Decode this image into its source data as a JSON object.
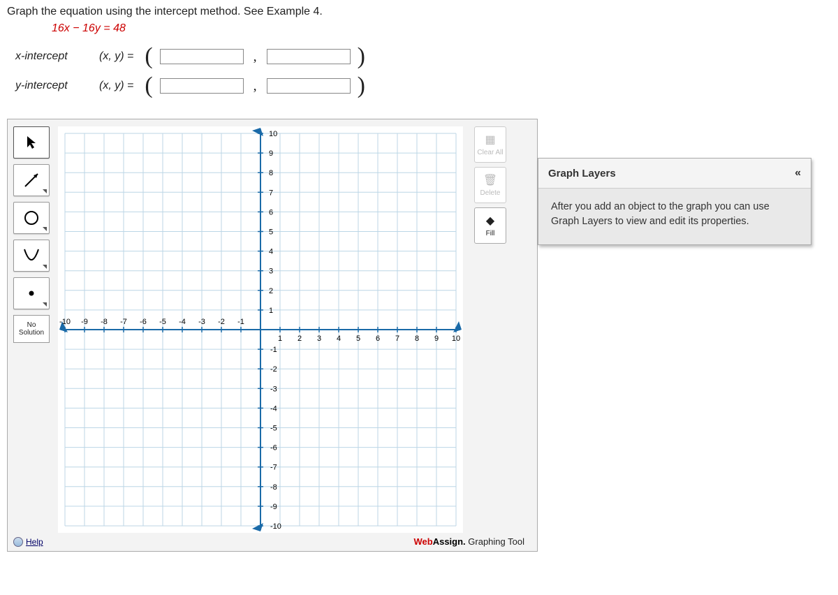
{
  "question": {
    "prompt": "Graph the equation using the intercept method. See Example 4.",
    "equation": "16x − 16y = 48",
    "intercepts": [
      {
        "label": "x-intercept",
        "xy": "(x, y) ="
      },
      {
        "label": "y-intercept",
        "xy": "(x, y) ="
      }
    ]
  },
  "toolbar": {
    "no_solution": "No Solution",
    "help": "Help"
  },
  "side_buttons": {
    "clear": "Clear All",
    "delete": "Delete",
    "fill": "Fill"
  },
  "layers": {
    "title": "Graph Layers",
    "body": "After you add an object to the graph you can use Graph Layers to view and edit its properties."
  },
  "branding": {
    "wa": "WebAssign.",
    "tool": " Graphing Tool"
  },
  "chart_data": {
    "type": "scatter",
    "title": "",
    "xlabel": "",
    "ylabel": "",
    "xlim": [
      -10,
      10
    ],
    "ylim": [
      -10,
      10
    ],
    "xticks": [
      -10,
      -9,
      -8,
      -7,
      -6,
      -5,
      -4,
      -3,
      -2,
      -1,
      1,
      2,
      3,
      4,
      5,
      6,
      7,
      8,
      9,
      10
    ],
    "yticks": [
      -10,
      -9,
      -8,
      -7,
      -6,
      -5,
      -4,
      -3,
      -2,
      -1,
      1,
      2,
      3,
      4,
      5,
      6,
      7,
      8,
      9,
      10
    ],
    "series": []
  }
}
